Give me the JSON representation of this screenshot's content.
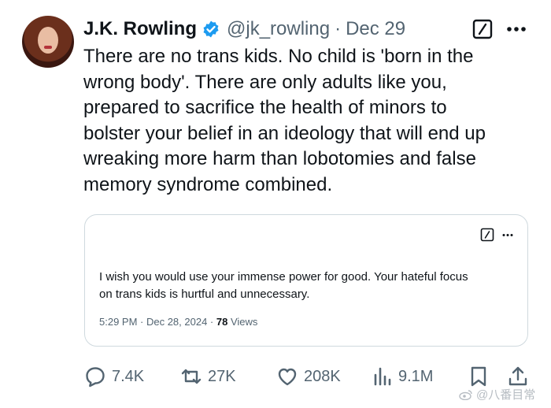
{
  "tweet": {
    "author_name": "J.K. Rowling",
    "handle": "@jk_rowling",
    "separator": "·",
    "date": "Dec 29",
    "lines": [
      "There are no trans kids. No child is 'born in the",
      "wrong body'. There are only adults like you,",
      "prepared to sacrifice the health of minors to",
      "bolster your belief in an ideology that will end up",
      "wreaking more harm than lobotomies and false",
      "memory syndrome combined."
    ]
  },
  "quoted": {
    "lines": [
      "I wish you would use your immense power for good. Your hateful focus",
      "on trans kids is hurtful and unnecessary."
    ],
    "timestamp": "5:29 PM · Dec 28, 2024 · ",
    "views_count": "78",
    "views_label": " Views"
  },
  "actions": {
    "replies": "7.4K",
    "reposts": "27K",
    "likes": "208K",
    "views": "9.1M"
  },
  "watermark": "@八番目常",
  "colors": {
    "text": "#0f1419",
    "secondary": "#536471",
    "verified": "#1d9bf0",
    "border": "#cfd9de"
  },
  "icons": [
    "verified-badge-icon",
    "grok-icon",
    "more-icon",
    "reply-icon",
    "repost-icon",
    "like-icon",
    "views-icon",
    "bookmark-icon",
    "share-icon"
  ]
}
